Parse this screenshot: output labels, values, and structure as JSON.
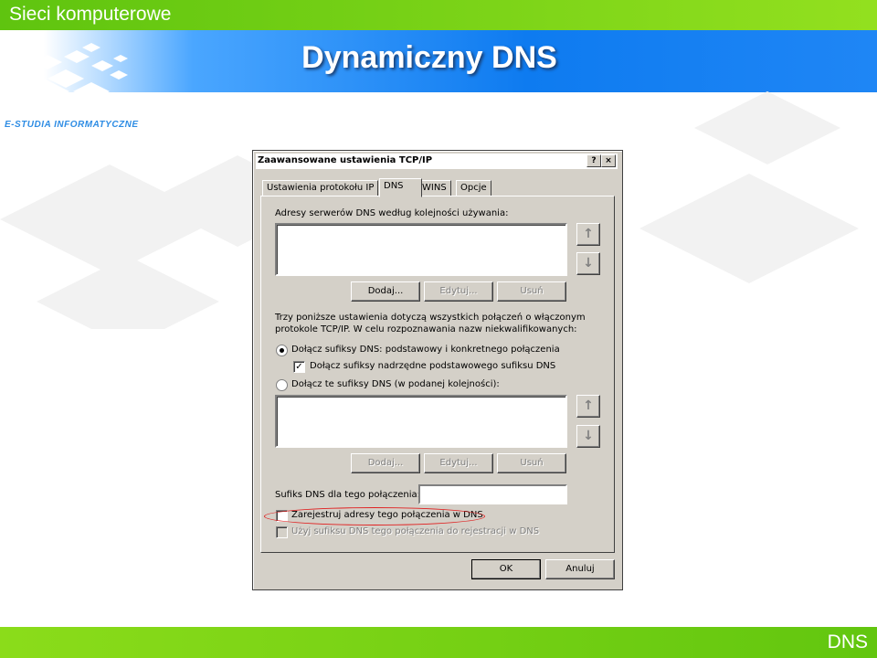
{
  "header": {
    "course_title": "Sieci komputerowe",
    "slide_title": "Dynamiczny DNS",
    "logo_text": "E-STUDIA INFORMATYCZNE"
  },
  "footer": {
    "section": "DNS"
  },
  "colors": {
    "header_green": "#6fce14",
    "title_blue": "#0e7bf0",
    "dialog_face": "#d4d0c8",
    "highlight_red": "#e02020"
  },
  "dialog": {
    "title": "Zaawansowane ustawienia TCP/IP",
    "help_button": "?",
    "close_button": "×",
    "tabs": [
      "Ustawienia protokołu IP",
      "DNS",
      "WINS",
      "Opcje"
    ],
    "active_tab": "DNS",
    "dns_servers_label": "Adresy serwerów DNS według kolejności używania:",
    "up_arrow_icon": "arrow-up-icon",
    "down_arrow_icon": "arrow-down-icon",
    "buttons_top": {
      "add": "Dodaj...",
      "edit": "Edytuj...",
      "remove": "Usuń"
    },
    "info_text_line1": "Trzy poniższe ustawienia dotyczą wszystkich połączeń o włączonym",
    "info_text_line2": "protokole TCP/IP. W celu rozpoznawania nazw niekwalifikowanych:",
    "radio_primary": "Dołącz sufiksy DNS: podstawowy i konkretnego połączenia",
    "checkbox_parent": "Dołącz sufiksy nadrzędne podstawowego sufiksu DNS",
    "radio_custom": "Dołącz te sufiksy DNS (w podanej kolejności):",
    "buttons_bottom": {
      "add": "Dodaj...",
      "edit": "Edytuj...",
      "remove": "Usuń"
    },
    "suffix_label": "Sufiks DNS dla tego połączenia:",
    "suffix_value": "",
    "register_label": "Zarejestruj adresy tego połączenia w DNS",
    "use_suffix_label": "Użyj sufiksu DNS tego połączenia do rejestracji w DNS",
    "ok": "OK",
    "cancel": "Anuluj"
  }
}
